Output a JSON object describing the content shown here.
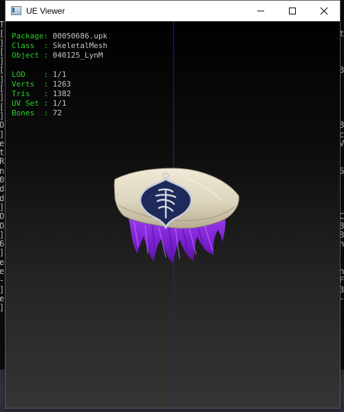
{
  "window": {
    "title": "UE Viewer",
    "icon": "app-icon"
  },
  "controls": {
    "minimize_icon": "minimize-icon",
    "maximize_icon": "maximize-icon",
    "close_icon": "close-icon"
  },
  "info": {
    "rows1": [
      {
        "key": "Package",
        "value": "00050686.upk"
      },
      {
        "key": "Class  ",
        "value": "SkeletalMesh"
      },
      {
        "key": "Object ",
        "value": "040125_LynM"
      }
    ],
    "rows2": [
      {
        "key": "LOD    ",
        "value": "1/1"
      },
      {
        "key": "Verts  ",
        "value": "1263"
      },
      {
        "key": "Tris   ",
        "value": "1382"
      },
      {
        "key": "UV Set ",
        "value": "1/1"
      },
      {
        "key": "Bones  ",
        "value": "72"
      }
    ]
  },
  "console_left": [
    "T",
    "[",
    "]",
    "[",
    "]",
    "[",
    "]",
    "[",
    "]",
    "[",
    "]",
    "O",
    "]",
    "e",
    "t",
    "R",
    "n",
    "0",
    "d",
    "d",
    "]",
    "O",
    "O",
    "]",
    "6",
    "]",
    "e",
    "e",
    "-",
    "]",
    "e",
    "]"
  ],
  "console_right": [
    "",
    "t",
    "",
    "",
    "",
    "3",
    "",
    "",
    "",
    "",
    "",
    "8",
    "c",
    "V",
    "",
    "",
    "6",
    "",
    "",
    "",
    "",
    "C",
    "8",
    "8",
    "n",
    "",
    "",
    "n",
    "F",
    "3",
    "-",
    "",
    ""
  ],
  "colors": {
    "info_key": "#28d228",
    "info_value": "#c8c8c8",
    "axis_line": "#1c1cc8",
    "hat": "#e2dcc8",
    "emblem": "#1e2a5a",
    "hair": "#8a2be2"
  }
}
